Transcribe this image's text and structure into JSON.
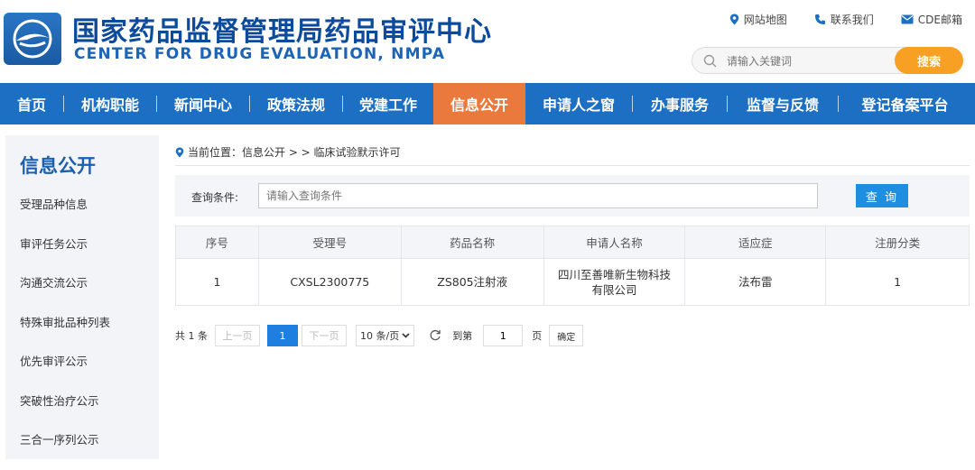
{
  "header": {
    "title_cn": "国家药品监督管理局药品审评中心",
    "title_en": "CENTER FOR DRUG EVALUATION, NMPA",
    "links": [
      {
        "label": "网站地图",
        "icon": "location-pin-icon"
      },
      {
        "label": "联系我们",
        "icon": "phone-icon"
      },
      {
        "label": "CDE邮箱",
        "icon": "mail-icon"
      }
    ],
    "search": {
      "placeholder": "请输入关键词",
      "button": "搜索"
    }
  },
  "nav": {
    "items": [
      "首页",
      "机构职能",
      "新闻中心",
      "政策法规",
      "党建工作",
      "信息公开",
      "申请人之窗",
      "办事服务",
      "监督与反馈",
      "登记备案平台"
    ],
    "active_index": 5
  },
  "sidebar": {
    "title": "信息公开",
    "items": [
      "受理品种信息",
      "审评任务公示",
      "沟通交流公示",
      "特殊审批品种列表",
      "优先审评公示",
      "突破性治疗公示",
      "三合一序列公示"
    ]
  },
  "breadcrumb": {
    "text": "当前位置：信息公开 > > 临床试验默示许可"
  },
  "query": {
    "label": "查询条件:",
    "placeholder": "请输入查询条件",
    "button": "查 询"
  },
  "table": {
    "headers": [
      "序号",
      "受理号",
      "药品名称",
      "申请人名称",
      "适应症",
      "注册分类"
    ],
    "rows": [
      {
        "index": "1",
        "acceptance_no": "CXSL2300775",
        "drug_name": "ZS805注射液",
        "applicant_line1": "四川至善唯新生物科技",
        "applicant_line2": "有限公司",
        "indication": "法布雷",
        "category": "1"
      }
    ]
  },
  "pager": {
    "total": "共 1 条",
    "prev": "上一页",
    "page": "1",
    "next": "下一页",
    "page_size": "10 条/页",
    "goto": "到第",
    "goto_value": "1",
    "page_unit": "页",
    "confirm": "确定"
  },
  "colors": {
    "brand_blue": "#1c6fc2",
    "active_orange": "#e9793d",
    "search_orange": "#f7a023",
    "button_blue": "#1e8fe0"
  }
}
